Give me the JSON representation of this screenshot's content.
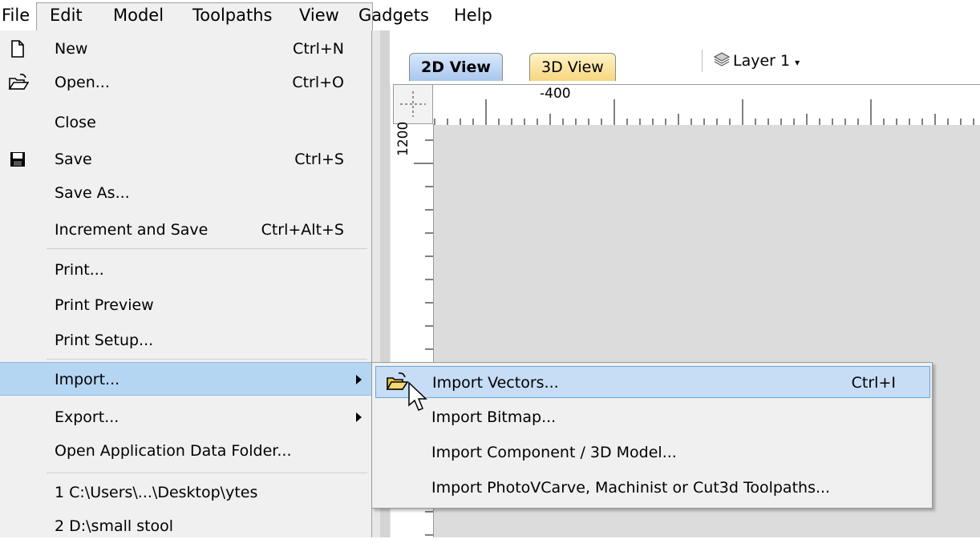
{
  "menubar": {
    "items": [
      "File",
      "Edit",
      "Model",
      "Toolpaths",
      "View",
      "Gadgets",
      "Help"
    ]
  },
  "tabs": {
    "tab_2d": "2D View",
    "tab_3d": "3D View"
  },
  "layer": {
    "label": "Layer 1"
  },
  "rulers": {
    "top_label": "-400",
    "left_label": "1200"
  },
  "file_menu": {
    "items": [
      {
        "label": "New",
        "shortcut": "Ctrl+N",
        "icon": "new-document-icon"
      },
      {
        "label": "Open...",
        "shortcut": "Ctrl+O",
        "icon": "open-folder-icon"
      },
      {
        "label": "Close",
        "shortcut": ""
      },
      {
        "label": "Save",
        "shortcut": "Ctrl+S",
        "icon": "floppy-disk-icon"
      },
      {
        "label": "Save As...",
        "shortcut": ""
      },
      {
        "label": "Increment and Save",
        "shortcut": "Ctrl+Alt+S"
      },
      {
        "label": "Print...",
        "shortcut": ""
      },
      {
        "label": "Print Preview",
        "shortcut": ""
      },
      {
        "label": "Print Setup...",
        "shortcut": ""
      },
      {
        "label": "Import...",
        "shortcut": "",
        "submenu": true
      },
      {
        "label": "Export...",
        "shortcut": "",
        "submenu": true
      },
      {
        "label": "Open Application Data Folder...",
        "shortcut": ""
      },
      {
        "label": "1 C:\\Users\\...\\Desktop\\ytes",
        "shortcut": ""
      },
      {
        "label": "2 D:\\small stool",
        "shortcut": ""
      }
    ]
  },
  "import_submenu": {
    "items": [
      {
        "label": "Import Vectors...",
        "shortcut": "Ctrl+I",
        "icon": "open-folder-icon"
      },
      {
        "label": "Import Bitmap...",
        "shortcut": ""
      },
      {
        "label": "Import Component / 3D Model...",
        "shortcut": ""
      },
      {
        "label": "Import PhotoVCarve, Machinist or Cut3d Toolpaths...",
        "shortcut": ""
      }
    ]
  },
  "colors": {
    "highlight": "#b5d6f3",
    "menu_bg": "#f0f0f0",
    "canvas_bg": "#dcdcdc",
    "tab_2d": "#a9c7ef",
    "tab_3d": "#f7d67f"
  }
}
